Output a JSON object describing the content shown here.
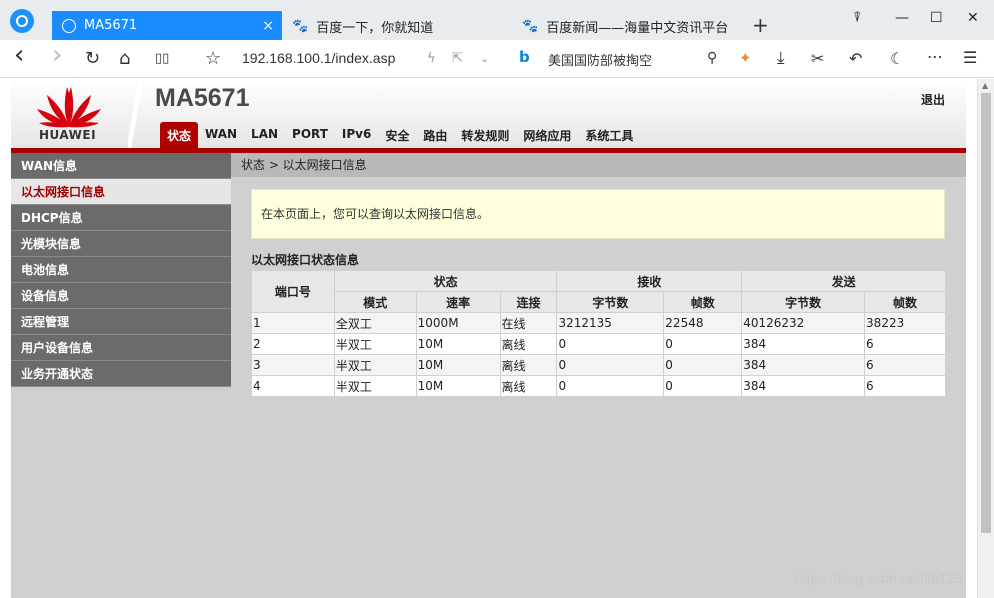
{
  "browser": {
    "tabs": [
      {
        "label": "MA5671",
        "close": "×"
      },
      {
        "label": "百度一下，你就知道"
      },
      {
        "label": "百度新闻——海量中文资讯平台"
      }
    ],
    "new_tab": "+",
    "window_controls": {
      "minimize": "—",
      "maximize": "☐",
      "close": "✕",
      "pin": "⍒"
    },
    "nav": {
      "back": "‹",
      "forward": "›",
      "reload": "↻",
      "home": "⌂",
      "reader": "▯▯",
      "star": "☆"
    },
    "url": "192.168.100.1/index.asp",
    "search_engine_icon": "b",
    "search_hot": "美国国防部被掏空",
    "toolbar_icons": [
      "search-icon",
      "game-icon",
      "download-icon",
      "scissors-icon",
      "undo-icon",
      "moon-icon",
      "more-icon",
      "menu-icon"
    ],
    "accent_color": "#1a8cff"
  },
  "header": {
    "brand": "HUAWEI",
    "model": "MA5671",
    "logout": "退出",
    "nav": [
      "状态",
      "WAN",
      "LAN",
      "PORT",
      "IPv6",
      "安全",
      "路由",
      "转发规则",
      "网络应用",
      "系统工具"
    ],
    "active_nav": "状态",
    "brand_color": "#a60000"
  },
  "sidebar": {
    "items": [
      "WAN信息",
      "以太网接口信息",
      "DHCP信息",
      "光模块信息",
      "电池信息",
      "设备信息",
      "远程管理",
      "用户设备信息",
      "业务开通状态"
    ],
    "active": "以太网接口信息"
  },
  "content": {
    "breadcrumb": "状态 > 以太网接口信息",
    "notice": "在本页面上，您可以查询以太网接口信息。",
    "section_title": "以太网接口状态信息",
    "table": {
      "group_headers": {
        "port": "端口号",
        "status": "状态",
        "rx": "接收",
        "tx": "发送"
      },
      "sub_headers": [
        "模式",
        "速率",
        "连接",
        "字节数",
        "帧数",
        "字节数",
        "帧数"
      ],
      "rows": [
        [
          "1",
          "全双工",
          "1000M",
          "在线",
          "3212135",
          "22548",
          "40126232",
          "38223"
        ],
        [
          "2",
          "半双工",
          "10M",
          "离线",
          "0",
          "0",
          "384",
          "6"
        ],
        [
          "3",
          "半双工",
          "10M",
          "离线",
          "0",
          "0",
          "384",
          "6"
        ],
        [
          "4",
          "半双工",
          "10M",
          "离线",
          "0",
          "0",
          "384",
          "6"
        ]
      ]
    }
  },
  "watermark": "https://blog.csdn.net/lfa123"
}
